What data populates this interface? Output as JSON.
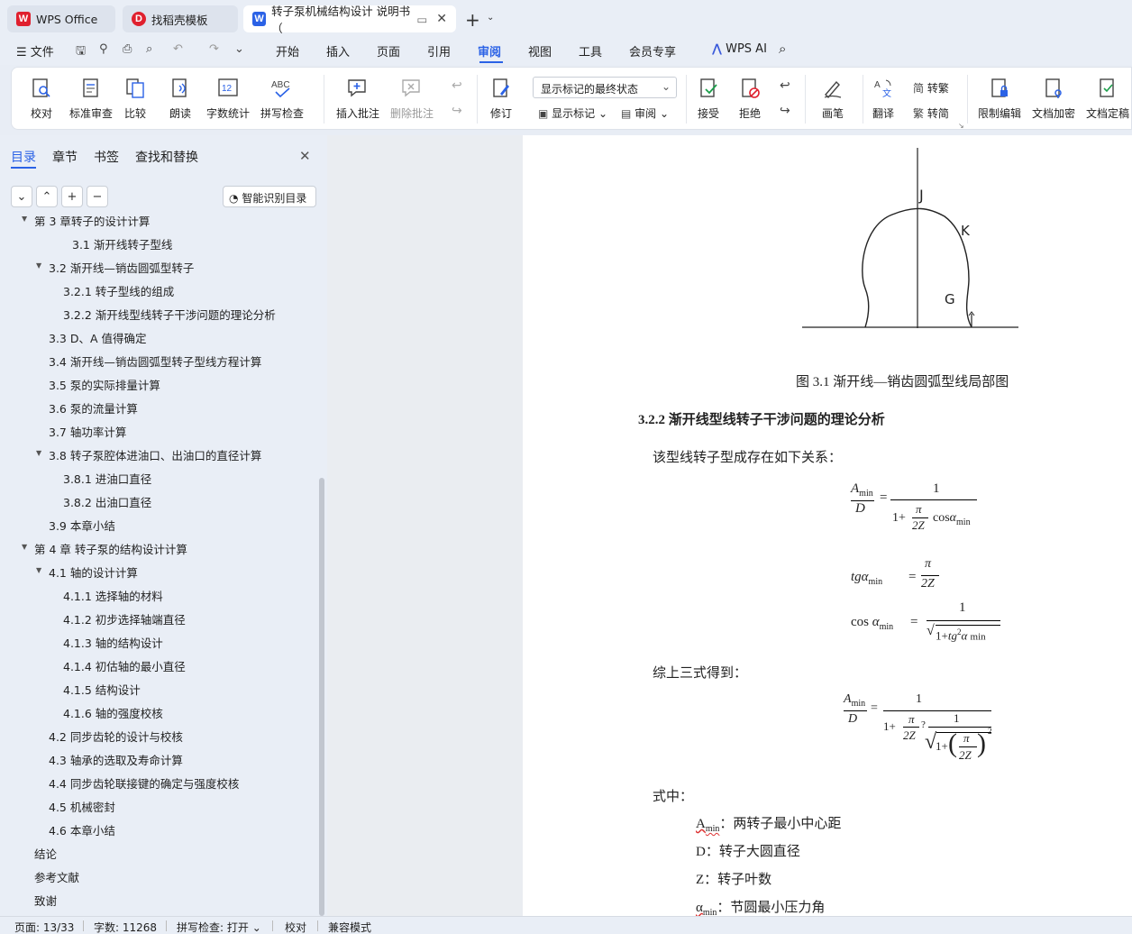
{
  "tabs": [
    {
      "label": "WPS Office",
      "color": "#e0202e",
      "glyph": "W"
    },
    {
      "label": "找稻壳模板",
      "color": "#e0202e",
      "glyph": "D"
    },
    {
      "label": "转子泵机械结构设计 说明书（",
      "color": "#2b62e6",
      "glyph": "W"
    }
  ],
  "menu": {
    "file": "文件",
    "items": [
      "开始",
      "插入",
      "页面",
      "引用",
      "审阅",
      "视图",
      "工具",
      "会员专享"
    ],
    "active": "审阅",
    "ai": "WPS AI"
  },
  "ribbon": {
    "proofread": "校对",
    "standard_review": "标准审查",
    "compare": "比较",
    "read_aloud": "朗读",
    "word_count": "字数统计",
    "spell_check": "拼写检查",
    "insert_comment": "插入批注",
    "delete_comment": "删除批注",
    "track_changes": "修订",
    "display_state": "显示标记的最终状态",
    "show_markup": "显示标记",
    "review_pane": "审阅",
    "accept": "接受",
    "reject": "拒绝",
    "pen": "画笔",
    "translate": "翻译",
    "to_traditional": "转繁",
    "to_simplified": "转简",
    "restrict_edit": "限制编辑",
    "doc_encrypt": "文档加密",
    "doc_finalize": "文档定稿"
  },
  "side_panel": {
    "tabs": [
      "目录",
      "章节",
      "书签",
      "查找和替换"
    ],
    "active_tab": "目录",
    "smart_toc": "智能识别目录",
    "toc": [
      {
        "label": "第 3 章转子的设计计算",
        "level": 1,
        "tri": "▼"
      },
      {
        "label": "3.1  渐开线转子型线",
        "level": 3,
        "tri": ""
      },
      {
        "label": "3.2  渐开线—销齿圆弧型转子",
        "level": 2,
        "tri": "▼"
      },
      {
        "label": "3.2.1  转子型线的组成",
        "level": 3,
        "tri": ""
      },
      {
        "label": "3.2.2  渐开线型线转子干涉问题的理论分析",
        "level": 3,
        "tri": ""
      },
      {
        "label": "3.3    D、A 值得确定",
        "level": 2,
        "tri": ""
      },
      {
        "label": "3.4  渐开线—销齿圆弧型转子型线方程计算",
        "level": 2,
        "tri": ""
      },
      {
        "label": "3.5  泵的实际排量计算",
        "level": 2,
        "tri": ""
      },
      {
        "label": "3.6  泵的流量计算",
        "level": 2,
        "tri": ""
      },
      {
        "label": "3.7  轴功率计算",
        "level": 2,
        "tri": ""
      },
      {
        "label": "3.8  转子泵腔体进油口、出油口的直径计算",
        "level": 2,
        "tri": "▼"
      },
      {
        "label": "3.8.1  进油口直径",
        "level": 3,
        "tri": ""
      },
      {
        "label": "3.8.2  出油口直径",
        "level": 3,
        "tri": ""
      },
      {
        "label": "3.9  本章小结",
        "level": 2,
        "tri": ""
      },
      {
        "label": "第 4 章    转子泵的结构设计计算",
        "level": 1,
        "tri": "▼"
      },
      {
        "label": "4.1 轴的设计计算",
        "level": 2,
        "tri": "▼"
      },
      {
        "label": "4.1.1  选择轴的材料",
        "level": 3,
        "tri": ""
      },
      {
        "label": "4.1.2  初步选择轴端直径",
        "level": 3,
        "tri": ""
      },
      {
        "label": "4.1.3  轴的结构设计",
        "level": 3,
        "tri": ""
      },
      {
        "label": "4.1.4  初估轴的最小直径",
        "level": 3,
        "tri": ""
      },
      {
        "label": "4.1.5  结构设计",
        "level": 3,
        "tri": ""
      },
      {
        "label": "4.1.6    轴的强度校核",
        "level": 3,
        "tri": ""
      },
      {
        "label": "4.2  同步齿轮的设计与校核",
        "level": 2,
        "tri": ""
      },
      {
        "label": "4.3  轴承的选取及寿命计算",
        "level": 2,
        "tri": ""
      },
      {
        "label": "4.4  同步齿轮联接键的确定与强度校核",
        "level": 2,
        "tri": ""
      },
      {
        "label": "4.5  机械密封",
        "level": 2,
        "tri": ""
      },
      {
        "label": "4.6  本章小结",
        "level": 2,
        "tri": ""
      },
      {
        "label": "结论",
        "level": 1,
        "tri": ""
      },
      {
        "label": "参考文献",
        "level": 1,
        "tri": ""
      },
      {
        "label": "致谢",
        "level": 1,
        "tri": ""
      }
    ]
  },
  "document": {
    "fig_labels": {
      "j": "J",
      "k": "K",
      "g": "G"
    },
    "caption": "图 3.1  渐开线—销齿圆弧型线局部图",
    "heading": "3.2.2  渐开线型线转子干涉问题的理论分析",
    "intro": "该型线转子型成存在如下关系：",
    "summary": "综上三式得到：",
    "where": "式中：",
    "defs": [
      {
        "sym": "A",
        "sub": "min",
        "text": "：两转子最小中心距"
      },
      {
        "sym": "D",
        "sub": "",
        "text": "：转子大圆直径"
      },
      {
        "sym": "Z",
        "sub": "",
        "text": "：转子叶数"
      },
      {
        "sym": "α",
        "sub": "min",
        "text": "：节圆最小压力角"
      }
    ],
    "math": {
      "A": "A",
      "min": "min",
      "D": "D",
      "eq": "=",
      "one": "1",
      "pi": "π",
      "twoZ": "2Z",
      "onePlus": "1+",
      "cos": "cos",
      "alpha": "α",
      "tg": "tg",
      "cosSpace": "cos ",
      "sq": "2",
      "q": "?",
      "root": "√"
    }
  },
  "status": {
    "page": "页面: 13/33",
    "words": "字数: 11268",
    "spell": "拼写检查: 打开",
    "proof": "校对",
    "compat": "兼容模式"
  }
}
